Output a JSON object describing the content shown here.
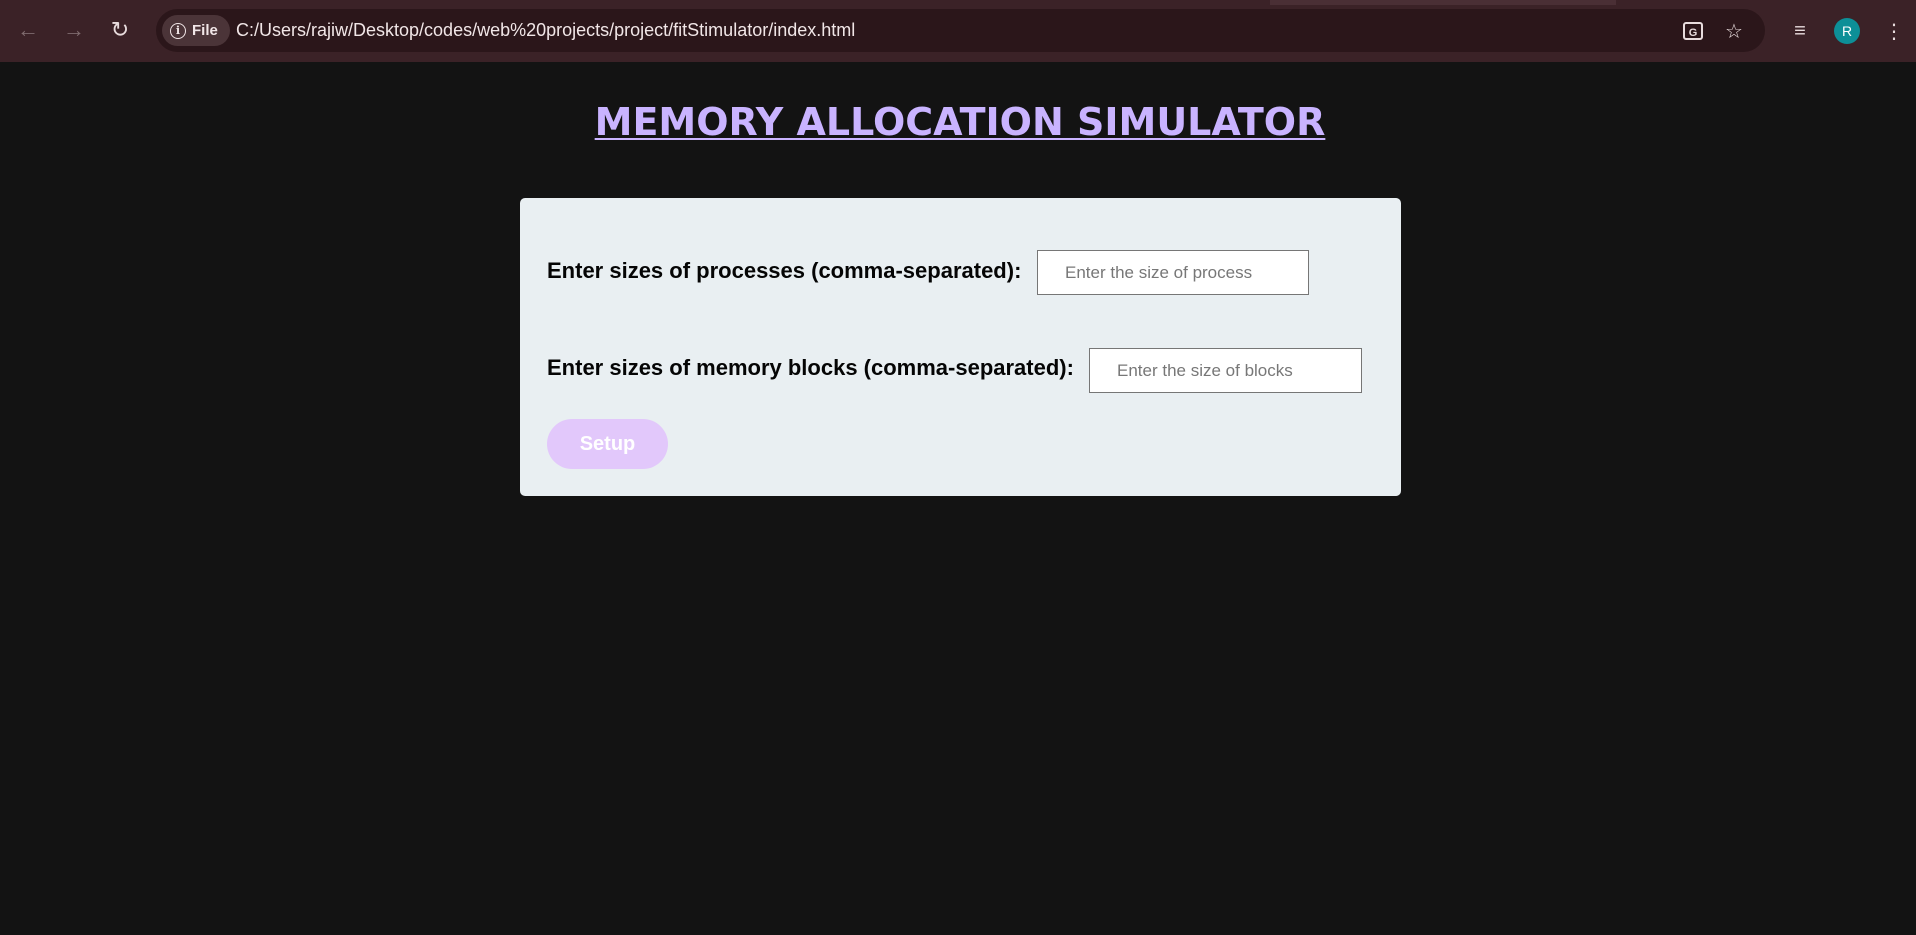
{
  "browser": {
    "back_icon": "arrow-left-icon",
    "forward_icon": "arrow-right-icon",
    "reload_icon": "reload-icon",
    "site_chip_label": "File",
    "url": "C:/Users/rajiw/Desktop/codes/web%20projects/project/fitStimulator/index.html",
    "translate_icon": "translate-icon",
    "bookmark_icon": "star-icon",
    "media_icon": "playlist-icon",
    "profile_initial": "R",
    "profile_color": "#0d8f97",
    "menu_icon": "kebab-menu-icon"
  },
  "page": {
    "title": "MEMORY ALLOCATION SIMULATOR",
    "title_color": "#c9b3ff",
    "background_color": "#131313"
  },
  "form": {
    "processes_label": "Enter sizes of processes (comma-separated):",
    "processes_placeholder": "Enter the size of process",
    "processes_value": "",
    "blocks_label": "Enter sizes of memory blocks (comma-separated):",
    "blocks_placeholder": "Enter the size of blocks",
    "blocks_value": "",
    "setup_label": "Setup",
    "setup_color": "#e2c8fb"
  }
}
